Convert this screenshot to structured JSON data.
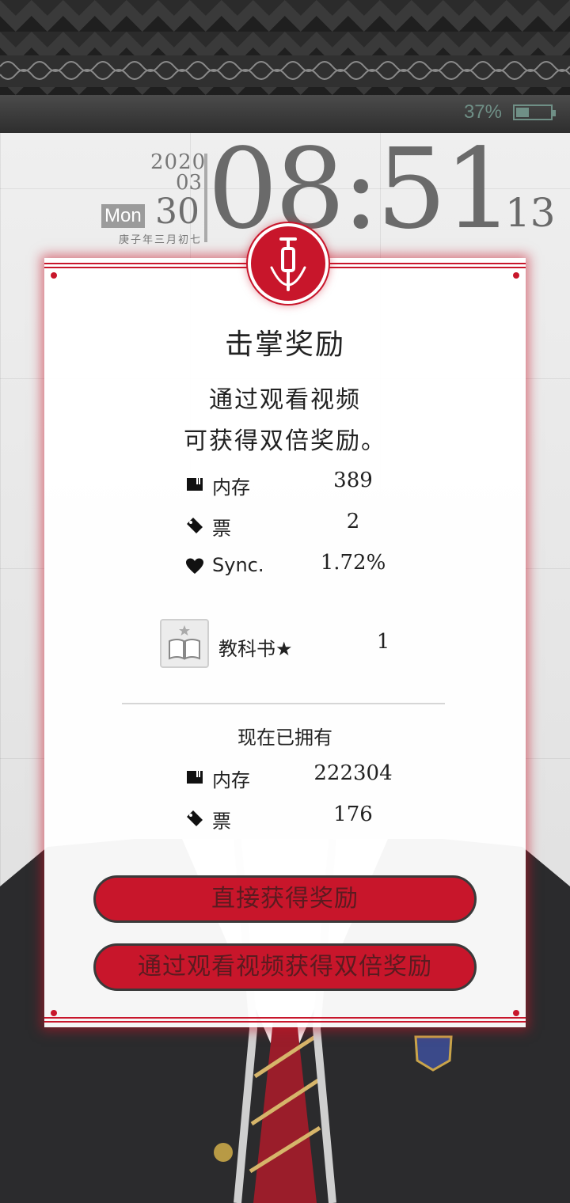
{
  "status": {
    "battery_text": "37%",
    "battery_level": 0.37
  },
  "clock": {
    "year": "2020",
    "month": "03",
    "weekday": "Mon",
    "day": "30",
    "lunar": "庚子年三月初七",
    "time": "08:51",
    "seconds": "13"
  },
  "dialog": {
    "title": "击掌奖励",
    "desc_line1": "通过观看视频",
    "desc_line2": "可获得双倍奖励。",
    "rewards": [
      {
        "icon": "memory-card-icon",
        "label": "内存",
        "value": "389"
      },
      {
        "icon": "ticket-icon",
        "label": "票",
        "value": "2"
      },
      {
        "icon": "heart-icon",
        "label": "Sync.",
        "value": "1.72%"
      }
    ],
    "book": {
      "icon": "textbook-icon",
      "label": "教科书★",
      "value": "1"
    },
    "owned_title": "现在已拥有",
    "owned": [
      {
        "icon": "memory-card-icon",
        "label": "内存",
        "value": "222304"
      },
      {
        "icon": "ticket-icon",
        "label": "票",
        "value": "176"
      }
    ],
    "button_direct": "直接获得奖励",
    "button_video": "通过观看视频获得双倍奖励",
    "emblem_icon": "syringe-icon"
  },
  "colors": {
    "accent": "#c8162b",
    "clock_text": "#6a6a6a",
    "battery": "#6f8f86"
  }
}
